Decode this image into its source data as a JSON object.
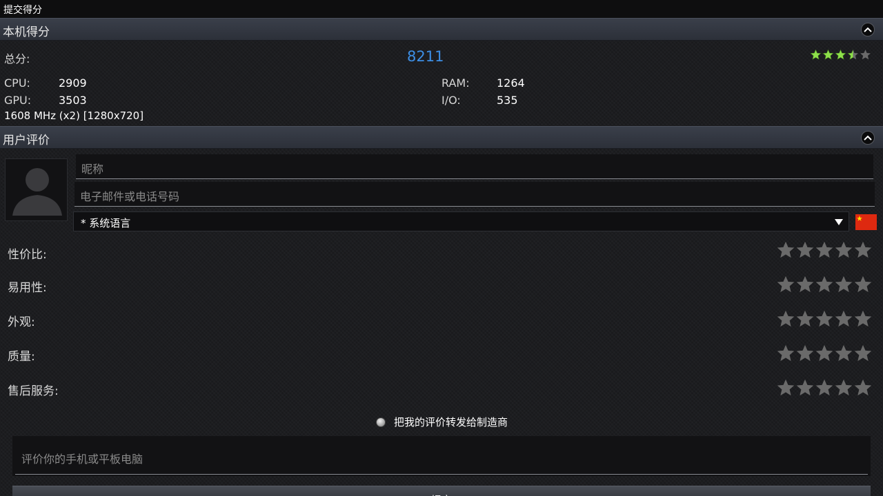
{
  "title_bar": {
    "title": "提交得分"
  },
  "device_score": {
    "header": "本机得分",
    "total_label": "总分:",
    "total_value": "8211",
    "total_rating": 3.5,
    "total_rating_max": 5,
    "cpu_label": "CPU:",
    "cpu_value": "2909",
    "gpu_label": "GPU:",
    "gpu_value": "3503",
    "ram_label": "RAM:",
    "ram_value": "1264",
    "io_label": "I/O:",
    "io_value": "535",
    "device_info": "1608 MHz (x2) [1280x720]"
  },
  "user_review": {
    "header": "用户评价",
    "nickname_placeholder": "昵称",
    "contact_placeholder": "电子邮件或电话号码",
    "language_selected": "* 系统语言",
    "flag": "china-flag",
    "ratings": [
      {
        "label": "性价比:",
        "value": 0,
        "max": 5
      },
      {
        "label": "易用性:",
        "value": 0,
        "max": 5
      },
      {
        "label": "外观:",
        "value": 0,
        "max": 5
      },
      {
        "label": "质量:",
        "value": 0,
        "max": 5
      },
      {
        "label": "售后服务:",
        "value": 0,
        "max": 5
      }
    ],
    "forward_label": "把我的评价转发给制造商",
    "comment_placeholder": "评价你的手机或平板电脑",
    "submit_label": "提交"
  },
  "colors": {
    "accent_score": "#3d8fe6",
    "star_filled": "#8ee04a",
    "star_empty": "#6a6a6a"
  }
}
